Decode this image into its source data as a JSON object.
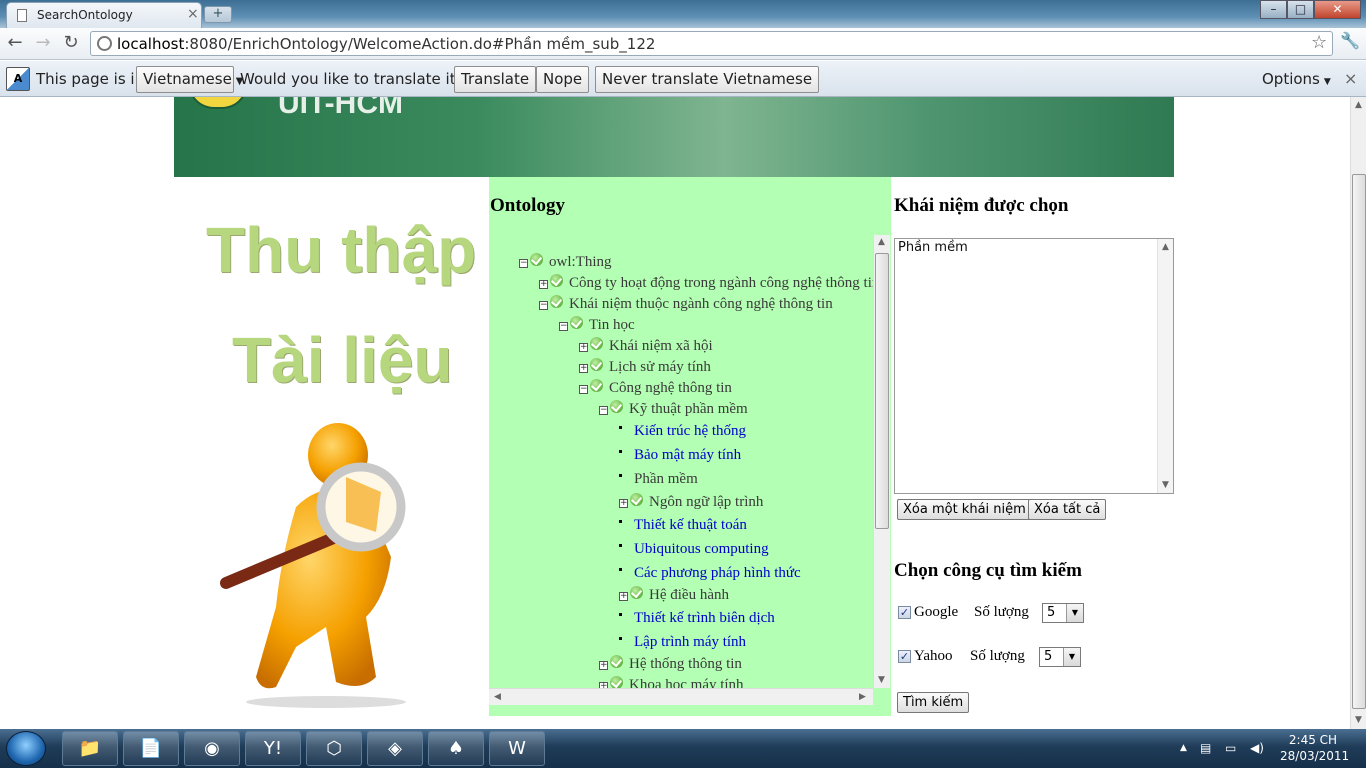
{
  "browser": {
    "tab_title": "SearchOntology",
    "tab_close": "×",
    "new_tab": "+",
    "url_host": "localhost",
    "url_rest": ":8080/EnrichOntology/WelcomeAction.do#Phần mềm_sub_122",
    "window_controls": {
      "minimize": "–",
      "maximize": "□",
      "close": "✕"
    }
  },
  "translate_bar": {
    "prefix": "This page is in",
    "language": "Vietnamese",
    "question": "Would you like to translate it?",
    "translate": "Translate",
    "nope": "Nope",
    "never": "Never translate Vietnamese",
    "options": "Options",
    "close": "×"
  },
  "banner": {
    "text": "UIT-HCM"
  },
  "left_image": {
    "line1": "Thu thập",
    "line2": "Tài liệu"
  },
  "ontology": {
    "heading": "Ontology",
    "nodes": [
      {
        "label": "owl:Thing",
        "type": "minus",
        "link": false
      },
      {
        "label": "Công ty hoạt động trong ngành công nghệ thông tin",
        "type": "plus",
        "link": false
      },
      {
        "label": "Khái niệm thuộc ngành công nghệ thông tin",
        "type": "minus",
        "link": false
      },
      {
        "label": "Tin học",
        "type": "minus",
        "link": false
      },
      {
        "label": "Khái niệm xã hội",
        "type": "plus",
        "link": false
      },
      {
        "label": "Lịch sử máy tính",
        "type": "plus",
        "link": false
      },
      {
        "label": "Công nghệ thông tin",
        "type": "minus",
        "link": false
      },
      {
        "label": "Kỹ thuật phần mềm",
        "type": "minus",
        "link": false
      },
      {
        "label": "Kiến trúc hệ thống",
        "type": "leaf",
        "link": true
      },
      {
        "label": "Bảo mật máy tính",
        "type": "leaf",
        "link": true
      },
      {
        "label": "Phần mềm",
        "type": "leaf",
        "link": false
      },
      {
        "label": "Ngôn ngữ lập trình",
        "type": "plus",
        "link": false
      },
      {
        "label": "Thiết kế thuật toán",
        "type": "leaf",
        "link": true
      },
      {
        "label": "Ubiquitous computing",
        "type": "leaf",
        "link": true
      },
      {
        "label": "Các phương pháp hình thức",
        "type": "leaf",
        "link": true
      },
      {
        "label": "Hệ điều hành",
        "type": "plus",
        "link": false
      },
      {
        "label": "Thiết kế trình biên dịch",
        "type": "leaf",
        "link": true
      },
      {
        "label": "Lập trình máy tính",
        "type": "leaf",
        "link": true
      },
      {
        "label": "Hệ thống thông tin",
        "type": "plus",
        "link": false
      },
      {
        "label": "Khoa học máy tính",
        "type": "plus",
        "link": false
      }
    ]
  },
  "selected": {
    "heading": "Khái niệm được chọn",
    "value": "Phần mềm",
    "remove_one": "Xóa một khái niệm",
    "remove_all": "Xóa tất cả"
  },
  "search_tools": {
    "heading": "Chọn công cụ tìm kiếm",
    "engines": [
      {
        "name": "Google",
        "checked": true,
        "qty_label": "Số lượng",
        "qty": "5"
      },
      {
        "name": "Yahoo",
        "checked": true,
        "qty_label": "Số lượng",
        "qty": "5"
      }
    ],
    "search_button": "Tìm kiếm"
  },
  "taskbar": {
    "time": "2:45 CH",
    "date": "28/03/2011",
    "apps": [
      "explorer-icon",
      "notepad-icon",
      "chrome-icon",
      "yahoo-messenger-icon",
      "virtualbox-icon",
      "game-icon",
      "solitaire-icon",
      "word-icon"
    ]
  }
}
